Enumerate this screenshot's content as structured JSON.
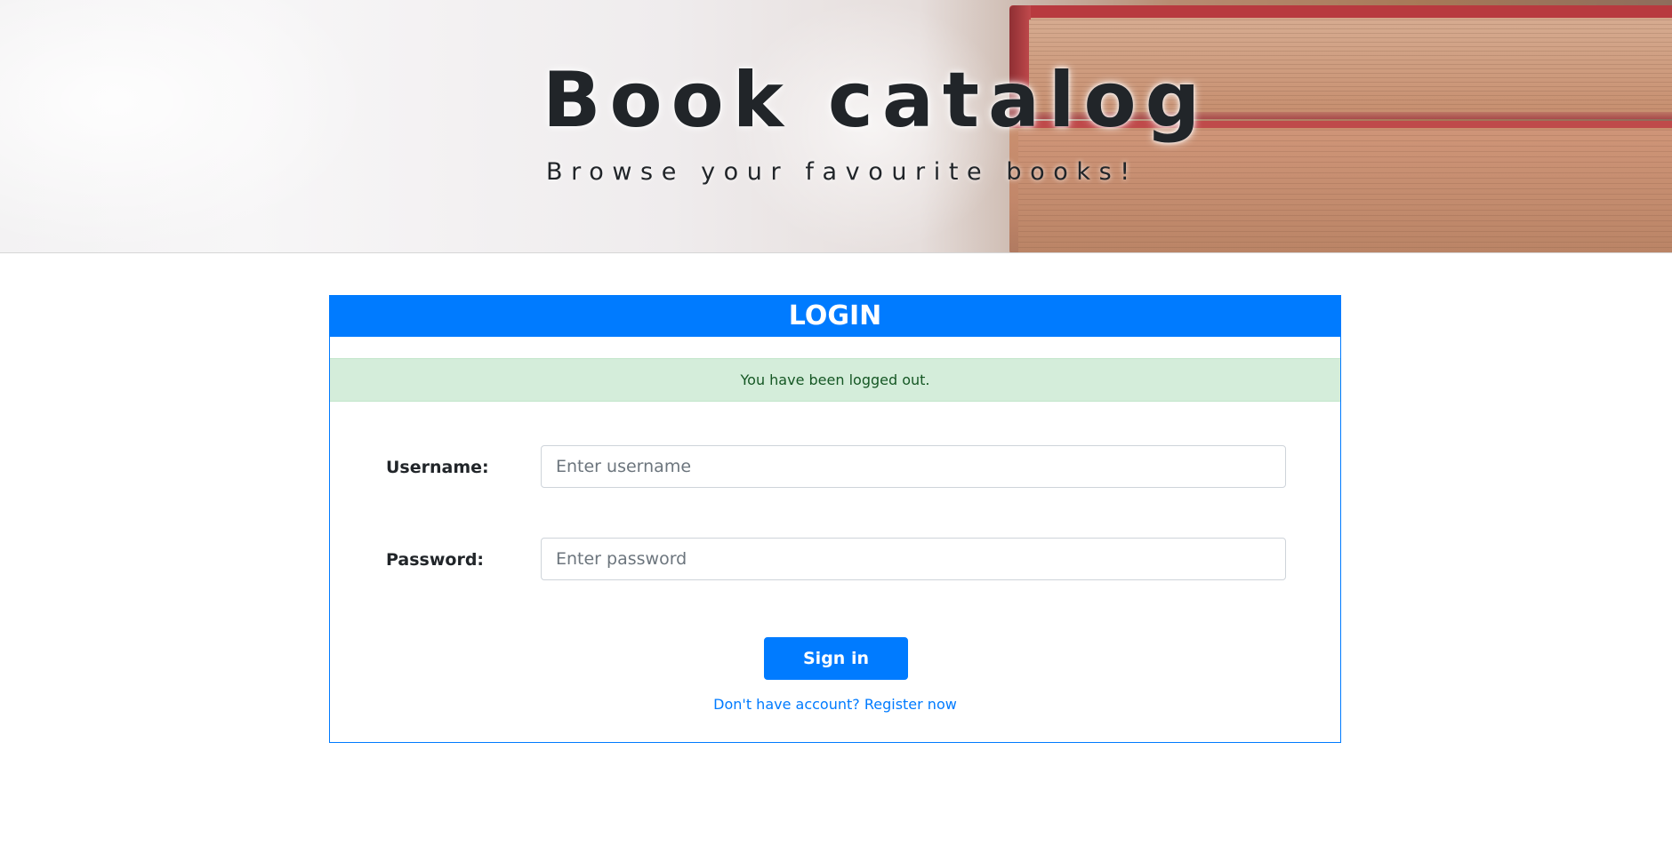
{
  "header": {
    "title": "Book catalog",
    "subtitle": "Browse your favourite books!"
  },
  "login": {
    "heading": "LOGIN",
    "alert": "You have been logged out.",
    "username_label": "Username:",
    "username_placeholder": "Enter username",
    "username_value": "",
    "password_label": "Password:",
    "password_placeholder": "Enter password",
    "password_value": "",
    "submit_label": "Sign in",
    "register_link": "Don't have account? Register now"
  },
  "colors": {
    "primary": "#007bff",
    "alert_bg": "#d4edda",
    "alert_text": "#155724",
    "text": "#212529"
  }
}
